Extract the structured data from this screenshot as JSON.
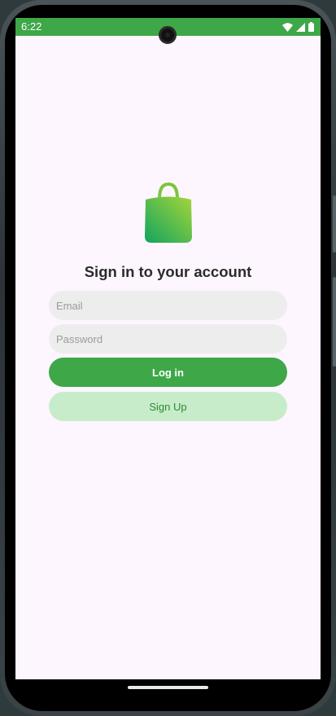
{
  "status_bar": {
    "time": "6:22",
    "icons": [
      "wifi-icon",
      "signal-icon",
      "battery-icon"
    ],
    "color": "#3ea748"
  },
  "logo": {
    "icon": "shopping-bag-icon",
    "colors": [
      "#1fa85a",
      "#8ed13a"
    ]
  },
  "login_form": {
    "title": "Sign in to your account",
    "email_placeholder": "Email",
    "email_value": "",
    "password_placeholder": "Password",
    "password_value": "",
    "login_label": "Log in",
    "signup_label": "Sign Up"
  },
  "colors": {
    "accent": "#3ea748",
    "accent_light": "#c7ecc9",
    "background": "#fdf6fe",
    "field_background": "#ededed"
  }
}
